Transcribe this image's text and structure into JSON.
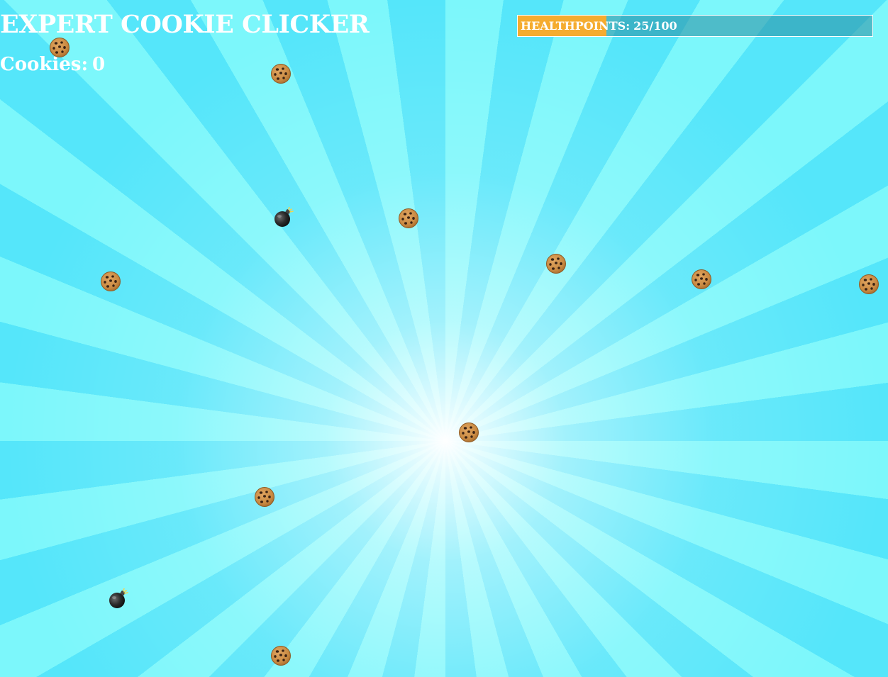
{
  "game": {
    "title": "EXPERT COOKIE CLICKER",
    "score_label": "Cookies:",
    "score_value": "0"
  },
  "health": {
    "label": "HEALTHPOINTS:",
    "display": "25/100",
    "current": 25,
    "max": 100
  },
  "colors": {
    "sky_light": "#7cf7fb",
    "sky_dark": "#55e6fa",
    "health_fill": "#f5ac2f",
    "text": "#ffffff"
  },
  "items": [
    {
      "type": "cookie",
      "icon": "cookie-icon"
    },
    {
      "type": "cookie",
      "icon": "cookie-icon"
    },
    {
      "type": "bomb",
      "icon": "bomb-icon"
    },
    {
      "type": "cookie",
      "icon": "cookie-icon"
    },
    {
      "type": "cookie",
      "icon": "cookie-icon"
    },
    {
      "type": "cookie",
      "icon": "cookie-icon"
    },
    {
      "type": "cookie",
      "icon": "cookie-icon"
    },
    {
      "type": "cookie",
      "icon": "cookie-icon"
    },
    {
      "type": "cookie",
      "icon": "cookie-icon"
    },
    {
      "type": "cookie",
      "icon": "cookie-icon"
    },
    {
      "type": "bomb",
      "icon": "bomb-icon"
    },
    {
      "type": "cookie",
      "icon": "cookie-icon"
    }
  ]
}
